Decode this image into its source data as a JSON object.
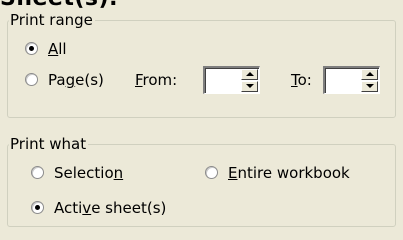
{
  "header": {
    "partial_text": "Sheet(s)."
  },
  "print_range": {
    "legend": "Print range",
    "options": [
      {
        "label_pre": "",
        "label_key": "A",
        "label_post": "ll",
        "selected": true
      },
      {
        "label_pre": "Pa",
        "label_key": "g",
        "label_post": "e(s)",
        "selected": false
      }
    ],
    "from": {
      "label_pre": "",
      "label_key": "F",
      "label_post": "rom:",
      "value": ""
    },
    "to": {
      "label_pre": "",
      "label_key": "T",
      "label_post": "o:",
      "value": ""
    }
  },
  "print_what": {
    "legend": "Print what",
    "options": [
      {
        "label_pre": "Selectio",
        "label_key": "n",
        "label_post": "",
        "selected": false
      },
      {
        "label_pre": "",
        "label_key": "E",
        "label_post": "ntire workbook",
        "selected": false
      },
      {
        "label_pre": "Acti",
        "label_key": "v",
        "label_post": "e sheet(s)",
        "selected": true
      }
    ]
  },
  "colors": {
    "dialog_background": "#ece9d8",
    "group_border": "#d0d0bf",
    "text": "#000000"
  }
}
